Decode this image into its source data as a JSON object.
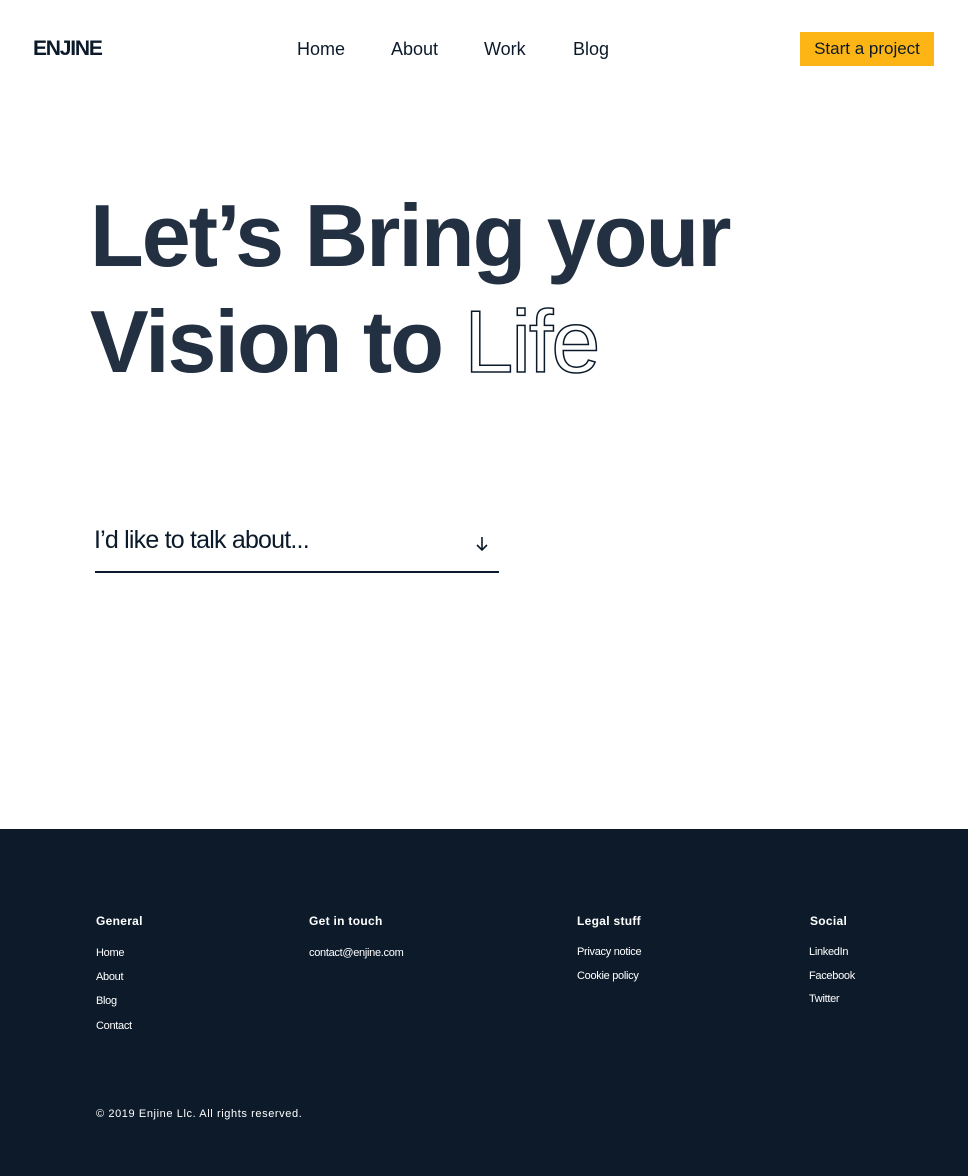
{
  "header": {
    "logo": "ENJINE",
    "nav": [
      "Home",
      "About",
      "Work",
      "Blog"
    ],
    "cta_label": "Start a project"
  },
  "hero": {
    "line1": "Let’s Bring your",
    "line2_solid": "Vision to",
    "line2_outline": "Life"
  },
  "topic_select": {
    "label": "I’d like to talk about...",
    "icon": "arrow-down-icon"
  },
  "footer": {
    "general": {
      "heading": "General",
      "links": [
        "Home",
        "About",
        "Blog",
        "Contact"
      ]
    },
    "contact": {
      "heading": "Get in touch",
      "email": "contact@enjine.com"
    },
    "legal": {
      "heading": "Legal stuff",
      "links": [
        "Privacy notice",
        "Cookie policy"
      ]
    },
    "social": {
      "heading": "Social",
      "links": [
        "LinkedIn",
        "Facebook",
        "Twitter"
      ]
    },
    "copyright": "© 2019 Enjine Llc. All rights reserved."
  },
  "colors": {
    "accent": "#fcb514",
    "text_dark": "#0b1a2a",
    "hero_text": "#223042",
    "footer_bg": "#0c1a2a"
  }
}
